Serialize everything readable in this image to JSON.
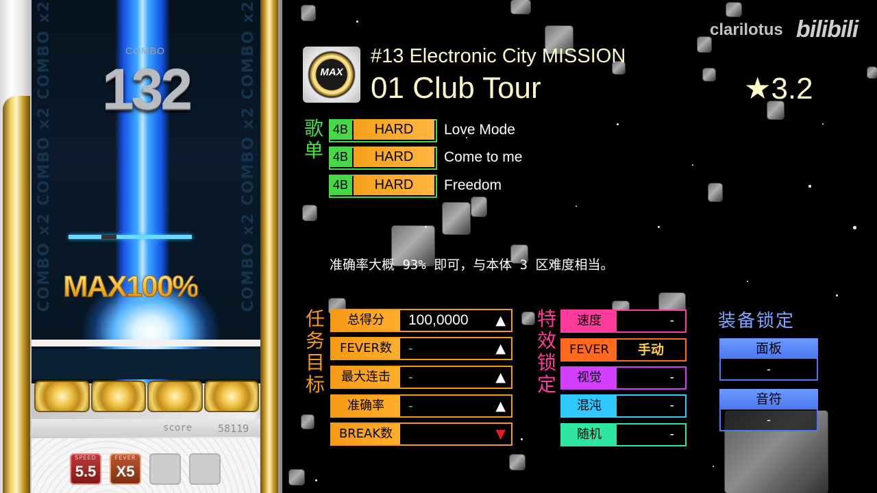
{
  "play": {
    "combo_label": "COMBO",
    "combo": "132",
    "combo_watermark": "COMBO x2  COMBO x2  COMBO x2",
    "max_text": "MAX100%",
    "score_label": "score",
    "score": "58119",
    "items": {
      "speed_caption": "SPEED",
      "speed_value": "5.5",
      "fever_caption": "FEVER",
      "fever_value": "X5"
    }
  },
  "header": {
    "logo_text": "MAX",
    "mission_title": "#13 Electronic City MISSION",
    "course_title": "01 Club Tour",
    "star": "★",
    "rating": "3.2",
    "watermark": "clarilotus",
    "bili": "bilibili"
  },
  "songs": {
    "label": "歌单",
    "rows": [
      {
        "button": "4B",
        "difficulty": "HARD",
        "name": "Love Mode"
      },
      {
        "button": "4B",
        "difficulty": "HARD",
        "name": "Come to me"
      },
      {
        "button": "4B",
        "difficulty": "HARD",
        "name": "Freedom"
      }
    ]
  },
  "note": "准确率大概 93% 即可，与本体 3 区难度相当。",
  "goals": {
    "label": "任务目标",
    "rows": [
      {
        "key": "总得分",
        "value": "100,0000",
        "arrow": "▲"
      },
      {
        "key": "FEVER数",
        "value": "-",
        "arrow": "▲"
      },
      {
        "key": "最大连击",
        "value": "-",
        "arrow": "▲"
      },
      {
        "key": "准确率",
        "value": "-",
        "arrow": "▲"
      },
      {
        "key": "BREAK数",
        "value": "",
        "arrow": "▼"
      }
    ]
  },
  "effects": {
    "label": "特效锁定",
    "rows": [
      {
        "key": "速度",
        "value": "-",
        "color": "#ff3b9b"
      },
      {
        "key": "FEVER",
        "value": "手动",
        "color": "#ff6a1f"
      },
      {
        "key": "视觉",
        "value": "-",
        "color": "#d23fff"
      },
      {
        "key": "混沌",
        "value": "-",
        "color": "#2fc9ff"
      },
      {
        "key": "随机",
        "value": "-",
        "color": "#2ee6a0"
      }
    ]
  },
  "equipment": {
    "title": "装备锁定",
    "panel_label": "面板",
    "panel_value": "-",
    "note_label": "音符",
    "note_value": "-"
  }
}
